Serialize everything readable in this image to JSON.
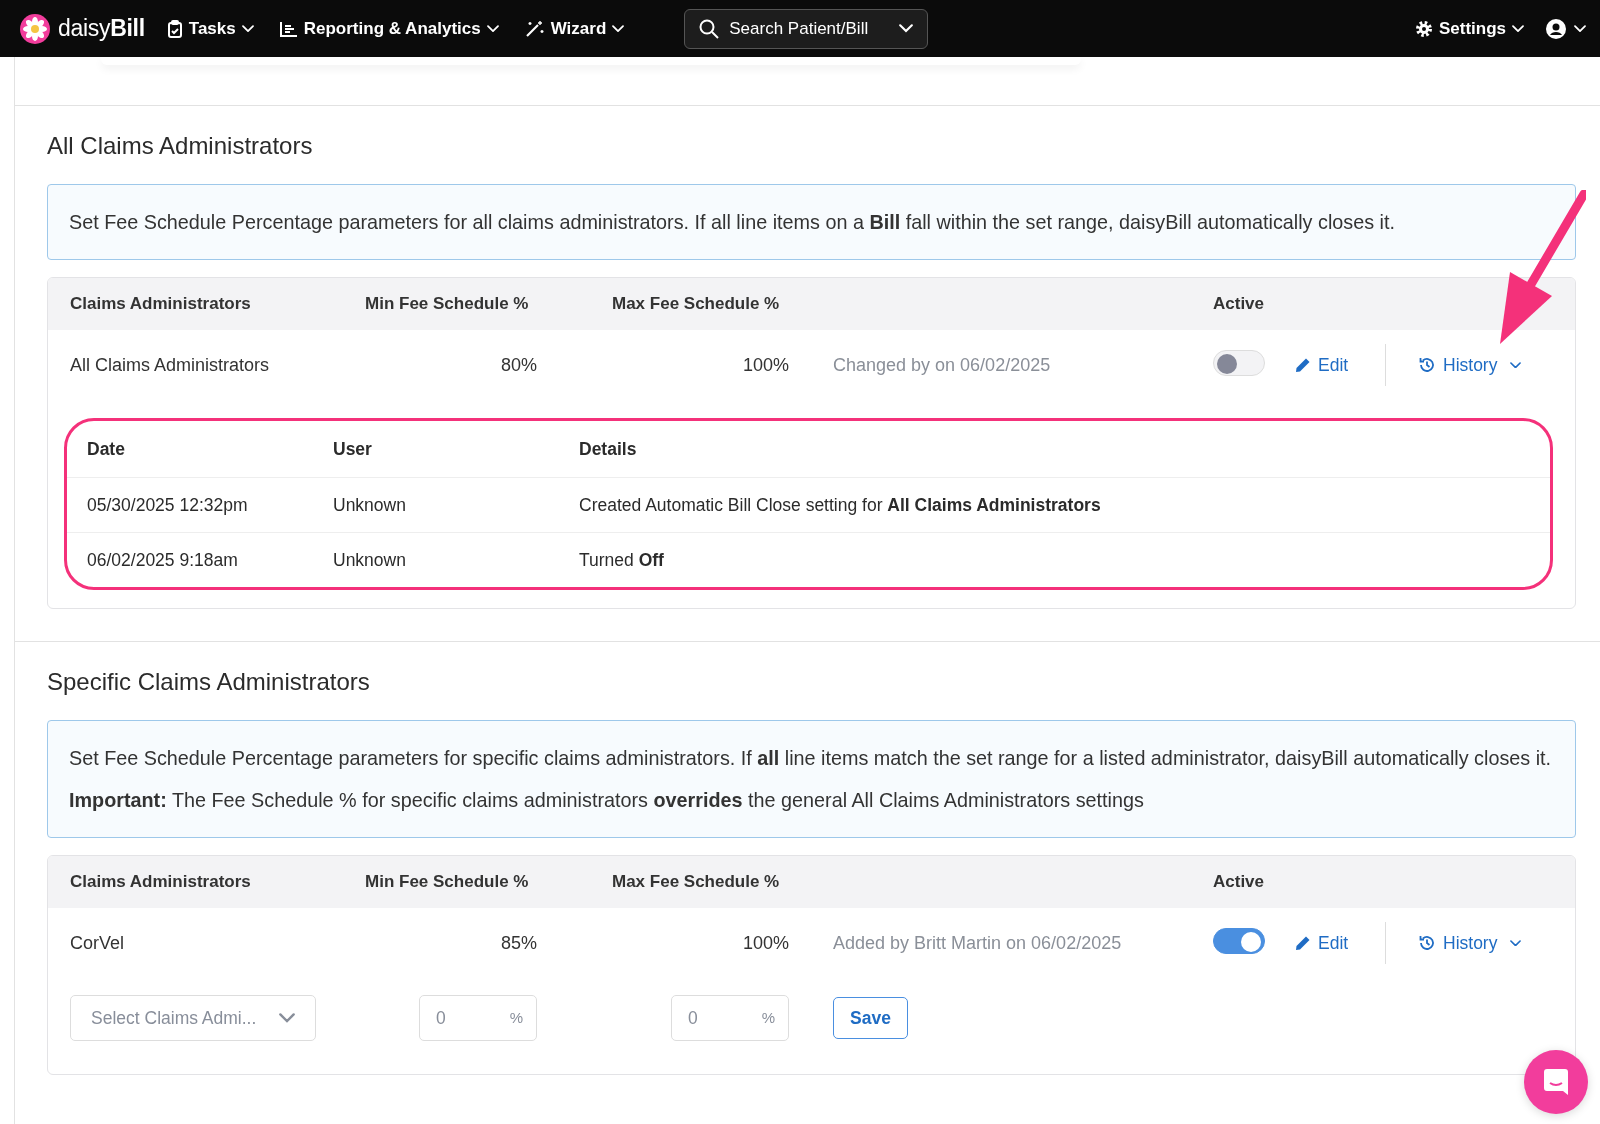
{
  "nav": {
    "logo": "daisy**Bill**",
    "menus": [
      {
        "label": "Tasks",
        "kind": "clipboard"
      },
      {
        "label": "Reporting & Analytics",
        "kind": "chart"
      },
      {
        "label": "Wizard",
        "kind": "wand"
      }
    ],
    "search": {
      "placeholder": "Search Patient/Bill"
    },
    "settings": "Settings"
  },
  "sections": [
    {
      "title": "All Claims Administrators",
      "info": [
        "Set Fee Schedule Percentage parameters for all claims administrators. If all line items on a **Bill** fall within the set range, daisyBill automatically closes it."
      ],
      "columns": [
        "Claims Administrators",
        "Min Fee Schedule %",
        "Max Fee Schedule %",
        "Active"
      ],
      "rows": [
        {
          "name": "All Claims Administrators",
          "min": "80%",
          "max": "100%",
          "note": "Changed by on 06/02/2025",
          "active": false,
          "edit": "Edit",
          "history": "History",
          "history_table": {
            "columns": [
              "Date",
              "User",
              "Details"
            ],
            "rows": [
              [
                "05/30/2025 12:32pm",
                "Unknown",
                "Created Automatic Bill Close setting for **All Claims Administrators**"
              ],
              [
                "06/02/2025 9:18am",
                "Unknown",
                "Turned **Off**"
              ]
            ]
          }
        }
      ]
    },
    {
      "title": "Specific Claims Administrators",
      "info": [
        "Set Fee Schedule Percentage parameters for specific claims administrators. If **all** line items match the set range for a listed administrator, daisyBill automatically closes it.",
        "**Important:** The Fee Schedule % for specific claims administrators **overrides** the general All Claims Administrators settings"
      ],
      "columns": [
        "Claims Administrators",
        "Min Fee Schedule %",
        "Max Fee Schedule %",
        "Active"
      ],
      "rows": [
        {
          "name": "CorVel",
          "min": "85%",
          "max": "100%",
          "note": "Added by Britt Martin on 06/02/2025",
          "active": true,
          "edit": "Edit",
          "history": "History"
        }
      ],
      "add_row": {
        "select": "Select Claims Admi...",
        "min": {
          "placeholder": "0",
          "unit": "%"
        },
        "max": {
          "placeholder": "0",
          "unit": "%"
        },
        "save": "Save"
      }
    }
  ]
}
